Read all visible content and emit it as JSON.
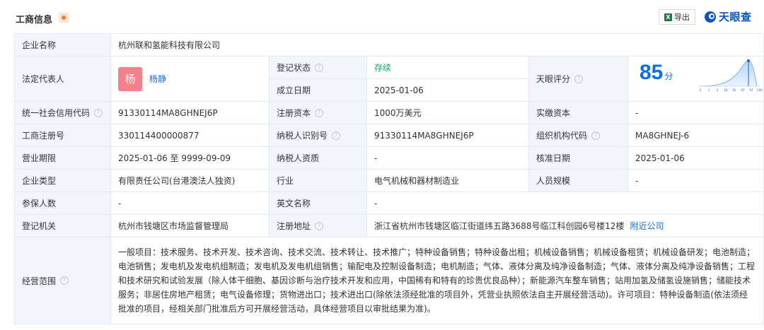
{
  "header": {
    "title": "工商信息",
    "export_label": "导出",
    "excel_glyph": "X",
    "brand_text": "天眼查"
  },
  "colors": {
    "accent": "#0f6fde",
    "status_ok": "#11a368",
    "label_bg": "#f2f6fc",
    "border": "#e4eaf3",
    "brand": "#0f52ba"
  },
  "icons": {
    "help": "question-circle-icon",
    "excel": "excel-icon",
    "brand": "tianyancha-logo-icon",
    "badge": "orange-dot-icon"
  },
  "company": {
    "name_label": "企业名称",
    "name": "杭州联和氢能科技有限公司",
    "legal_rep_label": "法定代表人",
    "legal_rep_avatar": "杨",
    "legal_rep_name": "杨静",
    "reg_status_label": "登记状态",
    "reg_status": "存续",
    "founded_label": "成立日期",
    "founded": "2025-01-06",
    "score_label": "天眼评分",
    "score": "85",
    "score_unit": "分",
    "score_axis": [
      "0",
      "1",
      "3",
      "18",
      "50",
      "67",
      "97",
      "100"
    ],
    "credit_code_label": "统一社会信用代码",
    "credit_code": "91330114MA8GHNEJ6P",
    "reg_capital_label": "注册资本",
    "reg_capital": "1000万美元",
    "paid_capital_label": "实缴资本",
    "paid_capital": "-",
    "reg_no_label": "工商注册号",
    "reg_no": "330114400000877",
    "taxpayer_id_label": "纳税人识别号",
    "taxpayer_id": "91330114MA8GHNEJ6P",
    "org_code_label": "组织机构代码",
    "org_code": "MA8GHNEJ-6",
    "term_label": "营业期限",
    "term": "2025-01-06 至 9999-09-09",
    "taxpayer_qual_label": "纳税人资质",
    "taxpayer_qual": "-",
    "approve_date_label": "核准日期",
    "approve_date": "2025-01-06",
    "type_label": "企业类型",
    "type": "有限责任公司(台港澳法人独资)",
    "industry_label": "行业",
    "industry": "电气机械和器材制造业",
    "staff_label": "人员规模",
    "staff": "-",
    "insured_label": "参保人数",
    "insured": "-",
    "english_label": "英文名称",
    "english": "-",
    "authority_label": "登记机关",
    "authority": "杭州市钱塘区市场监督管理局",
    "address_label": "注册地址",
    "address": "浙江省杭州市钱塘区临江街道纬五路3688号临江科创园6号楼12楼",
    "nearby_label": "附近公司",
    "scope_label": "经营范围",
    "scope": "一般项目：技术服务、技术开发、技术咨询、技术交流、技术转让、技术推广；特种设备销售；特种设备出租；机械设备销售；机械设备租赁；机械设备研发；电池制造；电池销售；发电机及发电机组制造；发电机及发电机组销售；输配电及控制设备制造；电机制造；气体、液体分离及纯净设备制造；气体、液体分离及纯净设备销售；工程和技术研究和试验发展（除人体干细胞、基因诊断与治疗技术开发和应用，中国稀有和特有的珍贵优良品种）；新能源汽车整车销售；站用加氢及储氢设施销售；储能技术服务；非居住房地产租赁；电气设备修理；货物进出口；技术进出口(除依法须经批准的项目外，凭营业执照依法自主开展经营活动)。许可项目：特种设备制造(依法须经批准的项目，经相关部门批准后方可开展经营活动，具体经营项目以审批结果为准)。"
  }
}
